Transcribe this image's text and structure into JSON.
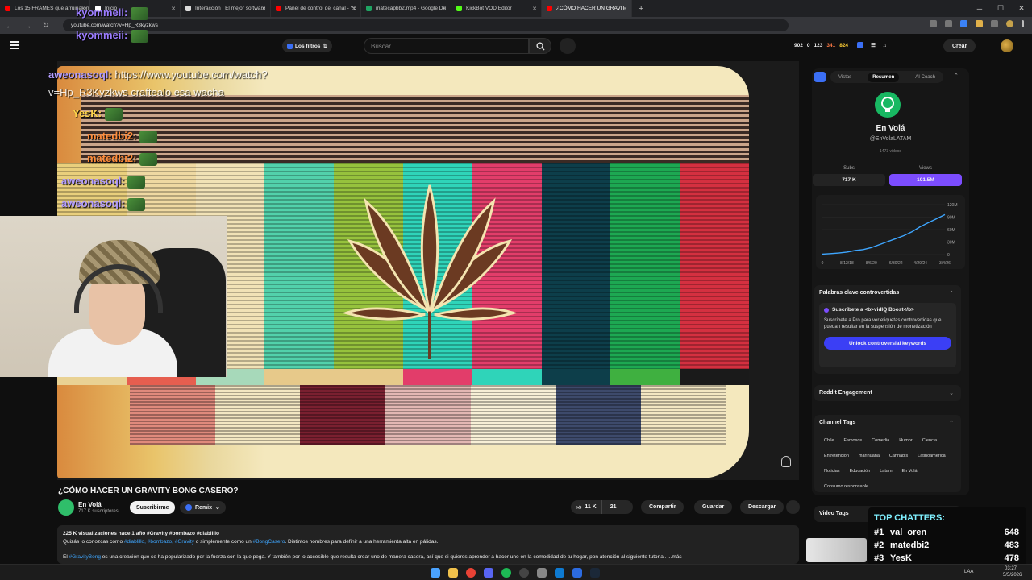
{
  "browser": {
    "tabs": [
      {
        "title": "Los 15 FRAMES que arruinaron",
        "favicon_color": "#ff0000"
      },
      {
        "title": "Inicio",
        "favicon_color": "#ffffff"
      },
      {
        "title": "Interacción | El mejor software",
        "favicon_color": "#dddddd"
      },
      {
        "title": "Panel de control del canal - Yo",
        "favicon_color": "#ff0000"
      },
      {
        "title": "matecapbb2.mp4 - Google Dri",
        "favicon_color": "#1fa463"
      },
      {
        "title": "KickBot VOD Editor",
        "favicon_color": "#53fc18"
      },
      {
        "title": "¿CÓMO HACER UN GRAVIT",
        "favicon_color": "#ff0000"
      }
    ],
    "url": "youtube.com/watch?v=Hp_R3kyzkws"
  },
  "youtube": {
    "filter_label": "Los filtros",
    "search_placeholder": "Buscar",
    "stats": [
      "902",
      "0",
      "123",
      "341",
      "824"
    ],
    "create_label": "Crear"
  },
  "stream_chat": [
    {
      "user": "kyommeii:",
      "text": "",
      "color": "#9b7cff"
    },
    {
      "user": "kyommeii:",
      "text": "",
      "color": "#9b7cff"
    },
    {
      "user": "aweonasoql:",
      "text": "https://www.youtube.com/watch?",
      "color": "#b39dff"
    },
    {
      "user": "",
      "text": "v=Hp_R3Kyzkws craftealo esa wacha",
      "color": "#ffffff"
    },
    {
      "user": "YesK:",
      "text": "",
      "color": "#ffd44a"
    },
    {
      "user": "matedbi2:",
      "text": "",
      "color": "#ff8c3a"
    },
    {
      "user": "matedbi2:",
      "text": "",
      "color": "#ff8c3a"
    },
    {
      "user": "aweonasoql:",
      "text": "",
      "color": "#b39dff"
    },
    {
      "user": "aweonasoql:",
      "text": "",
      "color": "#b39dff"
    }
  ],
  "video": {
    "title": "¿CÓMO HACER UN GRAVITY BONG CASERO?",
    "channel": "En Volá",
    "subscribers": "717 K suscriptores",
    "subscribe_label": "Suscribirme",
    "remix_label": "Remix",
    "likes": "11 K",
    "comments": "21",
    "share_label": "Compartir",
    "save_label": "Guardar",
    "download_label": "Descargar",
    "description_line1": "225 K visualizaciones  hace 1 año  #Gravity #bombazo #diablillo",
    "description_line2_pre": "Quizás lo conozcas como ",
    "description_tags2": "#diablillo, #bombazo, #Gravity",
    "description_line2_mid": " o simplemente como un ",
    "description_tag_bong": "#BongCasero",
    "description_line2_post": ". Distintos nombres para definir a una herramienta alta en pálidas.",
    "description_line3_pre": "El ",
    "description_tag_gb": "#GravityBong",
    "description_line3_post": " es una creación que se ha popularizado por la fuerza con la que pega. Y también por lo accesible que resulta crear uno de manera casera, así que si quieres aprender a hacer uno en la comodidad de tu hogar, pon atención al siguiente tutorial. ...más"
  },
  "vidiq": {
    "tabs": [
      "Vistas",
      "Resumen",
      "AI Coach"
    ],
    "channel_name": "En Volá",
    "handle": "@EnVolaLATAM",
    "video_count": "1473 videos",
    "subs_label": "Subs",
    "subs_value": "717 K",
    "views_label": "Views",
    "views_value": "101.5M",
    "graph_y_ticks": [
      "120M",
      "90M",
      "60M",
      "30M",
      "0"
    ],
    "graph_x_ticks": [
      "0",
      "8/12/18",
      "8/6/20",
      "6/30/22",
      "4/29/24",
      "3/4/26"
    ],
    "graph_trend": [
      0.01,
      0.02,
      0.03,
      0.05,
      0.08,
      0.1,
      0.14,
      0.2,
      0.26,
      0.32,
      0.38,
      0.46,
      0.56,
      0.64,
      0.72,
      0.8
    ],
    "controversial_title": "Palabras clave controvertidas",
    "promo_title": "Suscríbete a <b>vidIQ Boost</b>",
    "promo_text": "Suscríbete a Pro para ver etiquetas controvertidas que puedan resultar en la suspensión de monetización",
    "unlock_label": "Unlock controversial keywords",
    "reddit_title": "Reddit Engagement",
    "channel_tags_title": "Channel Tags",
    "channel_tags": [
      "Chile",
      "Famosos",
      "Comedia",
      "Humor",
      "Ciencia",
      "Entretención",
      "marihuana",
      "Cannabis",
      "Latinoamérica",
      "Noticias",
      "Educación",
      "Latam",
      "En Volá",
      "Consumo responsable"
    ],
    "video_tags_title": "Video Tags"
  },
  "top_chatters": {
    "title": "TOP CHATTERS:",
    "entries": [
      {
        "rank": "#1",
        "name": "val_oren",
        "count": "648"
      },
      {
        "rank": "#2",
        "name": "matedbi2",
        "count": "483"
      },
      {
        "rank": "#3",
        "name": "YesK",
        "count": "478"
      }
    ]
  },
  "taskbar": {
    "lang": "LAA",
    "time": "03:27",
    "date": "5/5/2026"
  }
}
